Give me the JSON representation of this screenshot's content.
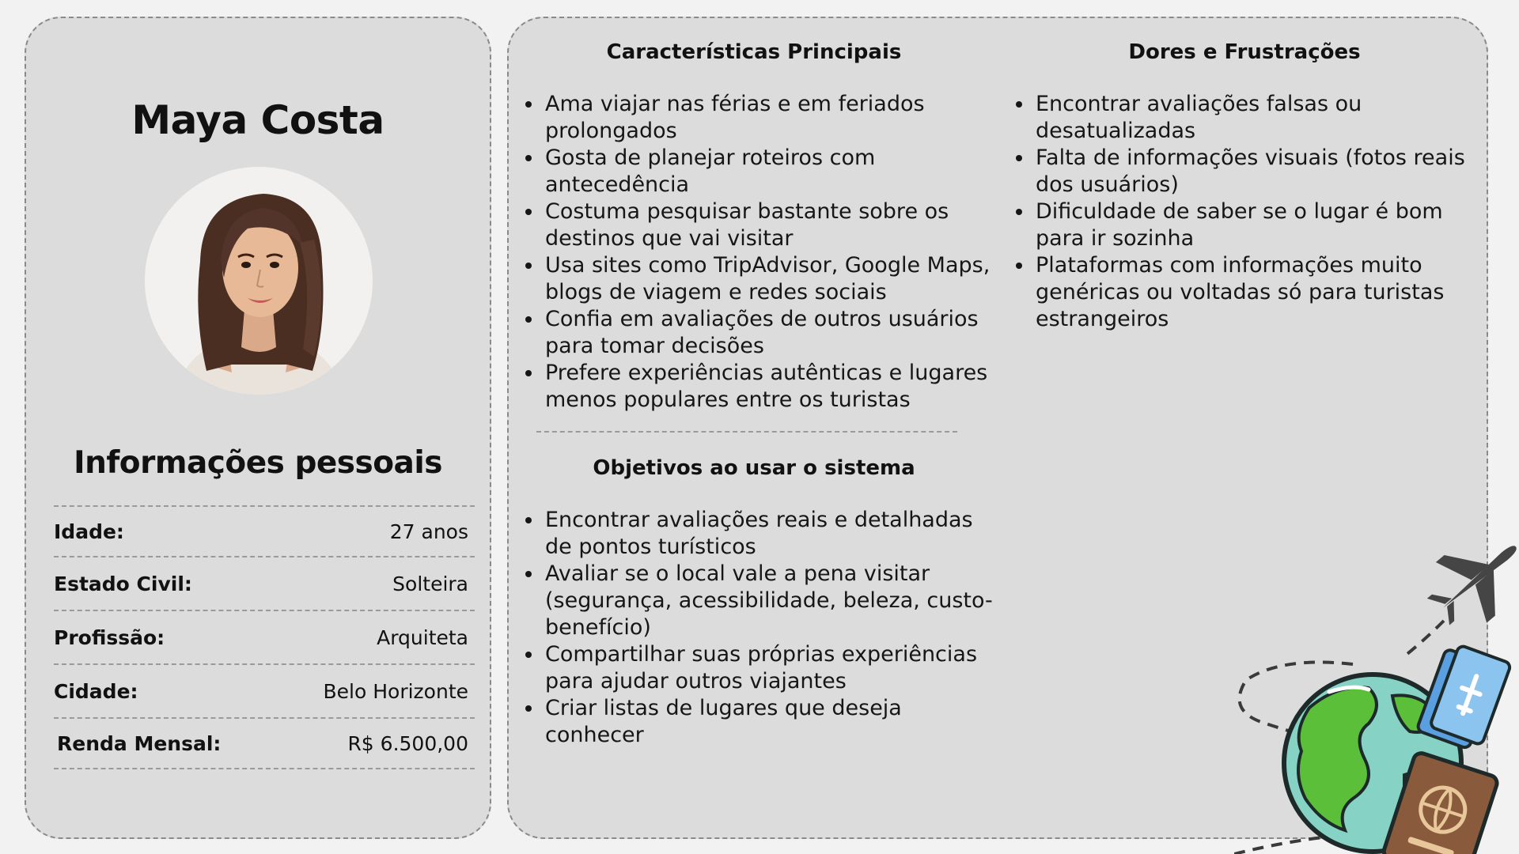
{
  "persona": {
    "name": "Maya Costa",
    "personal_info_title": "Informações pessoais",
    "info": [
      {
        "label": "Idade:",
        "value": "27 anos"
      },
      {
        "label": "Estado Civil:",
        "value": "Solteira"
      },
      {
        "label": "Profissão:",
        "value": "Arquiteta"
      },
      {
        "label": "Cidade:",
        "value": "Belo Horizonte"
      },
      {
        "label": "Renda Mensal:",
        "value": "R$ 6.500,00"
      }
    ]
  },
  "characteristics": {
    "title": "Características Principais",
    "items": [
      "Ama viajar nas férias e em feriados prolongados",
      "Gosta de planejar roteiros com antecedência",
      "Costuma pesquisar bastante sobre os destinos que vai visitar",
      "Usa sites como TripAdvisor, Google Maps, blogs de viagem e redes sociais",
      "Confia em avaliações de outros usuários para tomar decisões",
      "Prefere experiências autênticas e lugares menos populares entre os turistas"
    ]
  },
  "goals": {
    "title": "Objetivos ao usar o sistema",
    "items": [
      "Encontrar avaliações reais e detalhadas de pontos turísticos",
      "Avaliar se o local vale a pena visitar (segurança, acessibilidade, beleza, custo-benefício)",
      "Compartilhar suas próprias experiências para ajudar outros viajantes",
      "Criar listas de lugares que deseja conhecer"
    ]
  },
  "pains": {
    "title": "Dores e Frustrações",
    "items": [
      "Encontrar avaliações falsas ou desatualizadas",
      "Falta de informações visuais (fotos reais dos usuários)",
      "Dificuldade de saber se o lugar é bom para ir sozinha",
      "Plataformas com informações muito genéricas ou voltadas só para turistas estrangeiros"
    ]
  },
  "icons": {
    "avatar": "woman-portrait",
    "decoration": [
      "airplane-icon",
      "globe-icon",
      "passport-icon",
      "plane-tickets-icon"
    ]
  }
}
